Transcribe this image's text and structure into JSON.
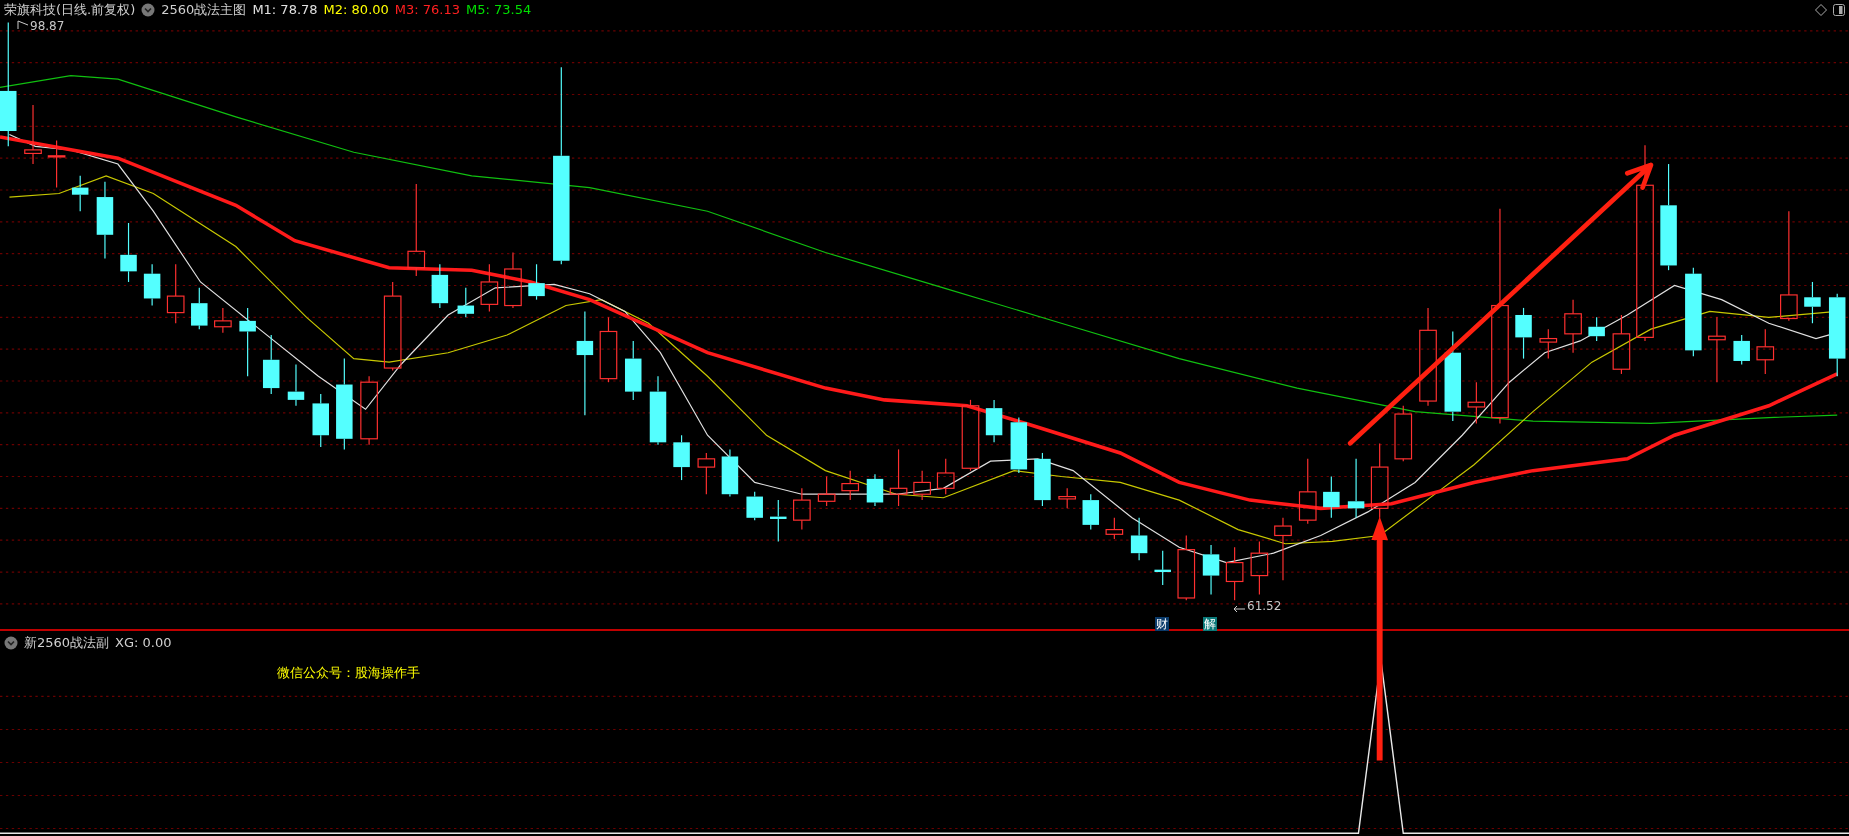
{
  "header": {
    "stock": "荣旗科技(日线.前复权)",
    "indicator": "2560战法主图",
    "values": [
      {
        "label": "M1: 78.78",
        "color": "#e0e0e0"
      },
      {
        "label": "M2: 80.00",
        "color": "#ffff00"
      },
      {
        "label": "M3: 76.13",
        "color": "#ff2020"
      },
      {
        "label": "M5: 73.54",
        "color": "#00e000"
      }
    ]
  },
  "main_chart": {
    "high_label": "98.87",
    "low_label": "61.52",
    "markers": [
      {
        "label": "财",
        "color": "#0a3a6a"
      },
      {
        "label": "解",
        "color": "#0a7a7a"
      }
    ]
  },
  "sub_panel": {
    "title": "新2560战法副",
    "readout": "XG: 0.00",
    "note": "微信公众号：股海操作手"
  }
}
